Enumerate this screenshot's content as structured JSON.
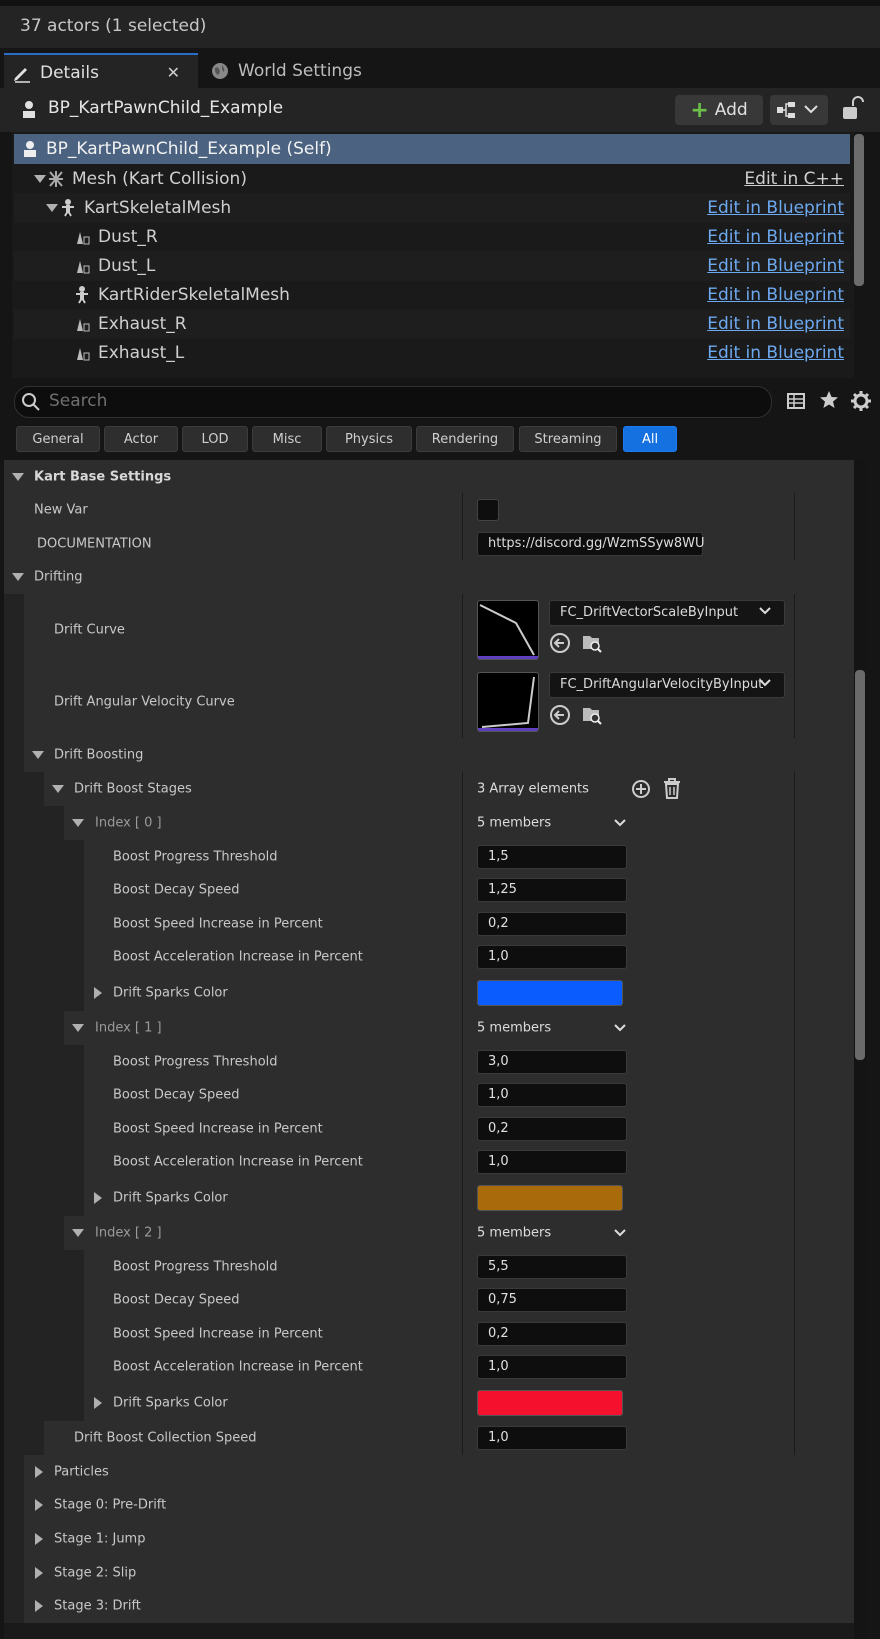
{
  "topbar": {
    "actors_text": "37 actors (1 selected)"
  },
  "tabs": {
    "details": "Details",
    "world_settings": "World Settings"
  },
  "header": {
    "title": "BP_KartPawnChild_Example",
    "add_label": "Add"
  },
  "components": [
    {
      "label": "BP_KartPawnChild_Example (Self)",
      "link": ""
    },
    {
      "label": "Mesh (Kart Collision)",
      "link": "Edit in C++"
    },
    {
      "label": "KartSkeletalMesh",
      "link": "Edit in Blueprint"
    },
    {
      "label": "Dust_R",
      "link": "Edit in Blueprint"
    },
    {
      "label": "Dust_L",
      "link": "Edit in Blueprint"
    },
    {
      "label": "KartRiderSkeletalMesh",
      "link": "Edit in Blueprint"
    },
    {
      "label": "Exhaust_R",
      "link": "Edit in Blueprint"
    },
    {
      "label": "Exhaust_L",
      "link": "Edit in Blueprint"
    }
  ],
  "search": {
    "placeholder": "Search"
  },
  "filters": [
    "General",
    "Actor",
    "LOD",
    "Misc",
    "Physics",
    "Rendering",
    "Streaming",
    "All"
  ],
  "props": {
    "kart_base_settings": "Kart Base Settings",
    "new_var": "New Var",
    "documentation": "DOCUMENTATION",
    "documentation_value": "https://discord.gg/WzmSSyw8WU",
    "drifting": "Drifting",
    "drift_curve": "Drift Curve",
    "drift_curve_value": "FC_DriftVectorScaleByInput",
    "drift_angular": "Drift Angular Velocity Curve",
    "drift_angular_value": "FC_DriftAngularVelocityByInput",
    "drift_boosting": "Drift Boosting",
    "drift_boost_stages": "Drift Boost Stages",
    "array_elements": "3 Array elements",
    "collection_speed": "Drift Boost Collection Speed",
    "collection_speed_value": "1,0"
  },
  "labels": {
    "threshold": "Boost Progress Threshold",
    "decay": "Boost Decay Speed",
    "speed_inc": "Boost Speed Increase in Percent",
    "accel_inc": "Boost Acceleration Increase in Percent",
    "sparks": "Drift Sparks Color",
    "members": "5 members"
  },
  "stages": [
    {
      "index_label": "Index [ 0 ]",
      "threshold": "1,5",
      "decay": "1,25",
      "speed_inc": "0,2",
      "accel_inc": "1,0",
      "color": "#0a5cff"
    },
    {
      "index_label": "Index [ 1 ]",
      "threshold": "3,0",
      "decay": "1,0",
      "speed_inc": "0,2",
      "accel_inc": "1,0",
      "color": "#a86a0a"
    },
    {
      "index_label": "Index [ 2 ]",
      "threshold": "5,5",
      "decay": "0,75",
      "speed_inc": "0,2",
      "accel_inc": "1,0",
      "color": "#f5102e"
    }
  ],
  "collapsed_sections": [
    "Particles",
    "Stage 0: Pre-Drift",
    "Stage 1: Jump",
    "Stage 2: Slip",
    "Stage 3: Drift"
  ]
}
